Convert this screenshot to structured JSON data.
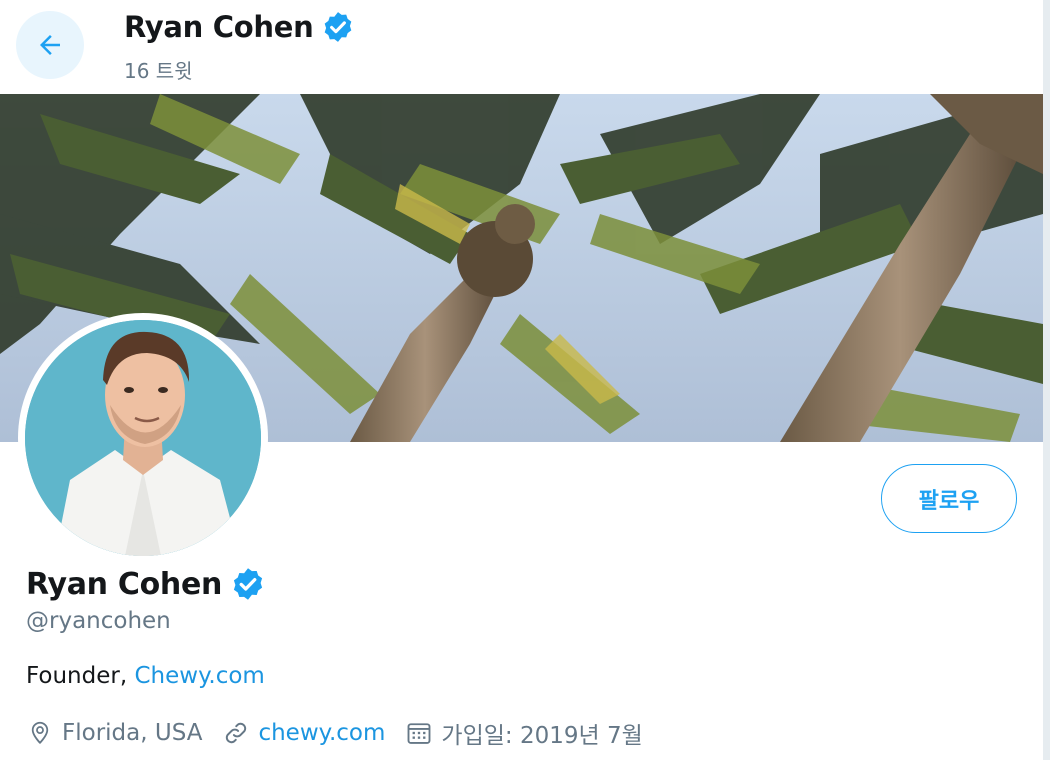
{
  "header": {
    "back_icon": "arrow-left-icon",
    "title": "Ryan Cohen",
    "verified_icon": "verified-badge-icon",
    "tweet_count": "16 트윗"
  },
  "banner": {
    "description_icon": "palm-trees-banner-image"
  },
  "avatar": {
    "icon": "profile-photo"
  },
  "actions": {
    "follow_label": "팔로우"
  },
  "profile": {
    "name": "Ryan Cohen",
    "handle": "@ryancohen",
    "bio_prefix": "Founder, ",
    "bio_link": "Chewy.com",
    "location_icon": "location-pin-icon",
    "location": "Florida, USA",
    "link_icon": "link-icon",
    "website": "chewy.com",
    "calendar_icon": "calendar-icon",
    "joined": "가입일: 2019년 7월"
  },
  "colors": {
    "accent": "#1da1f2",
    "link": "#1b95e0",
    "secondary_text": "#657786",
    "primary_text": "#14171a"
  }
}
